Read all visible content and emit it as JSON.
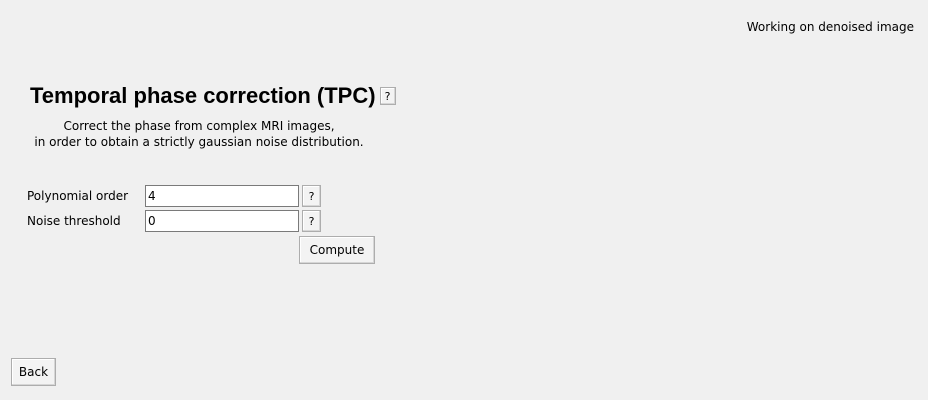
{
  "status": {
    "text": "Working on denoised image"
  },
  "header": {
    "title": "Temporal phase correction (TPC)",
    "help_label": "?"
  },
  "description": {
    "line1": "Correct the phase from complex MRI images,",
    "line2": "in order to obtain a strictly gaussian noise distribution."
  },
  "form": {
    "polynomial_order": {
      "label": "Polynomial order",
      "value": "4",
      "help_label": "?"
    },
    "noise_threshold": {
      "label": "Noise threshold",
      "value": "0",
      "help_label": "?"
    },
    "compute_label": "Compute"
  },
  "footer": {
    "back_label": "Back"
  }
}
